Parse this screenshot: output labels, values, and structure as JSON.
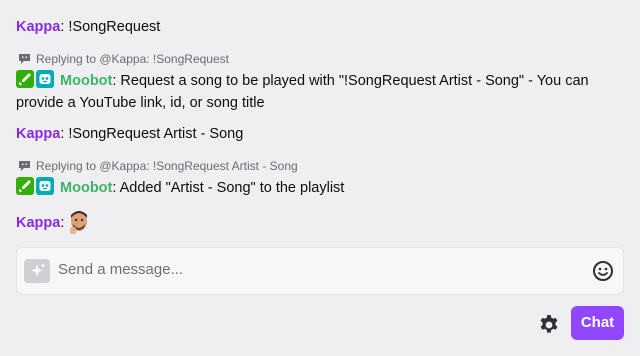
{
  "colors": {
    "kappa": "#8a2be2",
    "moobot": "#3fb36b",
    "accent": "#9147ff"
  },
  "messages": [
    {
      "user": "Kappa",
      "sep": ":",
      "text": " !SongRequest"
    },
    {
      "reply_to": "Replying to @Kappa: !SongRequest",
      "badges": [
        "moderator-sword-icon",
        "bot-icon"
      ],
      "user": "Moobot",
      "sep": ":",
      "text": " Request a song to be played with \"!SongRequest Artist - Song\" - You can provide a YouTube link, id, or song title"
    },
    {
      "user": "Kappa",
      "sep": ":",
      "text": " !SongRequest Artist - Song"
    },
    {
      "reply_to": "Replying to @Kappa: !SongRequest Artist - Song",
      "badges": [
        "moderator-sword-icon",
        "bot-icon"
      ],
      "user": "Moobot",
      "sep": ":",
      "text": " Added \"Artist - Song\" to the playlist"
    },
    {
      "user": "Kappa",
      "sep": ":",
      "emote": "face-emote"
    }
  ],
  "input": {
    "placeholder": "Send a message..."
  },
  "chat_button": {
    "label": "Chat"
  },
  "icons": {
    "reply": "reply-bubble-icon",
    "ai": "sparkle-icon",
    "emoji": "smiley-icon",
    "settings": "gear-icon"
  }
}
